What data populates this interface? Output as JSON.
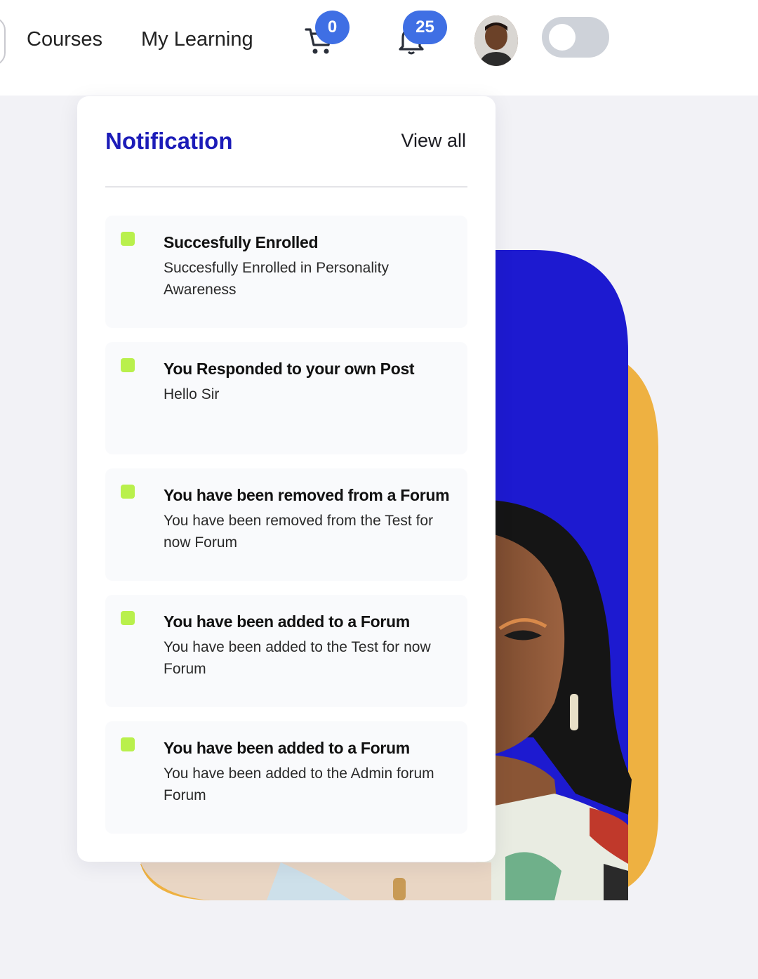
{
  "nav": {
    "links": [
      "Courses",
      "My Learning"
    ],
    "cart_count": "0",
    "notification_count": "25",
    "icons": [
      "cart-icon",
      "bell-icon"
    ],
    "theme_toggle_on": false
  },
  "colors": {
    "accent_blue": "#1c1cb8",
    "badge_blue": "#3f6fe4",
    "status_green": "#b9f04c",
    "hero_orange": "#eeb141"
  },
  "panel": {
    "title": "Notification",
    "view_all": "View all",
    "items": [
      {
        "title": "Succesfully Enrolled",
        "body": "Succesfully Enrolled in Personality Awareness"
      },
      {
        "title": "You Responded to your own Post",
        "body": "Hello Sir"
      },
      {
        "title": "You have been removed from a Forum",
        "body": "You have been removed from the Test for now Forum"
      },
      {
        "title": "You have been added to a Forum",
        "body": "You have been added to the Test for now Forum"
      },
      {
        "title": "You have been added to a Forum",
        "body": "You have been added to the Admin forum Forum"
      }
    ]
  }
}
